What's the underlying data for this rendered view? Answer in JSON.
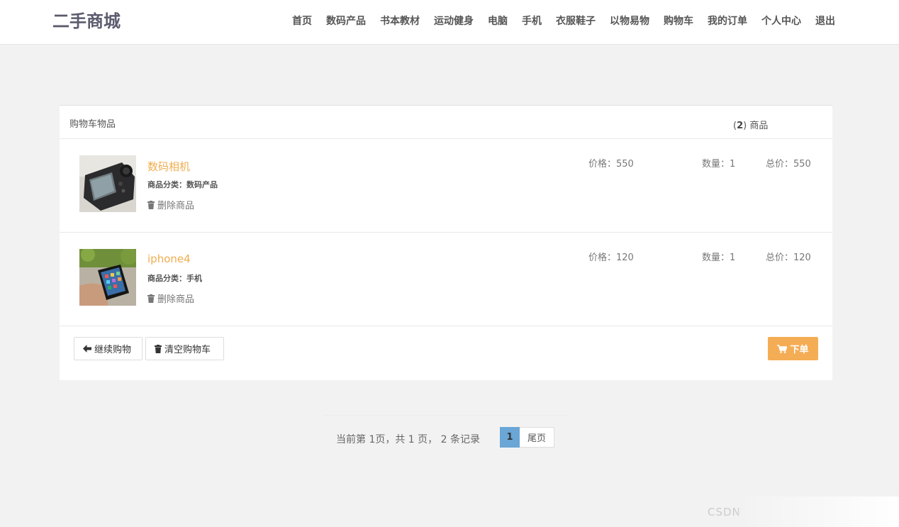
{
  "brand": "二手商城",
  "nav": [
    "首页",
    "数码产品",
    "书本教材",
    "运动健身",
    "电脑",
    "手机",
    "衣服鞋子",
    "以物易物",
    "购物车",
    "我的订单",
    "个人中心",
    "退出"
  ],
  "cart": {
    "title": "购物车物品",
    "count": "2",
    "count_suffix": " 商品",
    "items": [
      {
        "name": "数码相机",
        "category": "商品分类：数码产品",
        "delete_label": "删除商品",
        "price": "价格：550",
        "quantity": "数量：1",
        "total": "总价：550",
        "image_icon": "camera-photo"
      },
      {
        "name": "iphone4",
        "category": "商品分类：手机",
        "delete_label": "删除商品",
        "price": "价格：120",
        "quantity": "数量：1",
        "total": "总价：120",
        "image_icon": "phone-photo"
      }
    ],
    "continue_label": "继续购物",
    "clear_label": "清空购物车",
    "order_label": "下单"
  },
  "pagination": {
    "summary": "当前第 1页，共 1 页， 2 条记录",
    "current_page": "1",
    "last_label": "尾页"
  },
  "watermark": "CSDN",
  "colors": {
    "accent": "#f0ad4e",
    "order_button": "#f5ad55",
    "active_page": "#6aa6d6",
    "background": "#f2f2f2"
  }
}
